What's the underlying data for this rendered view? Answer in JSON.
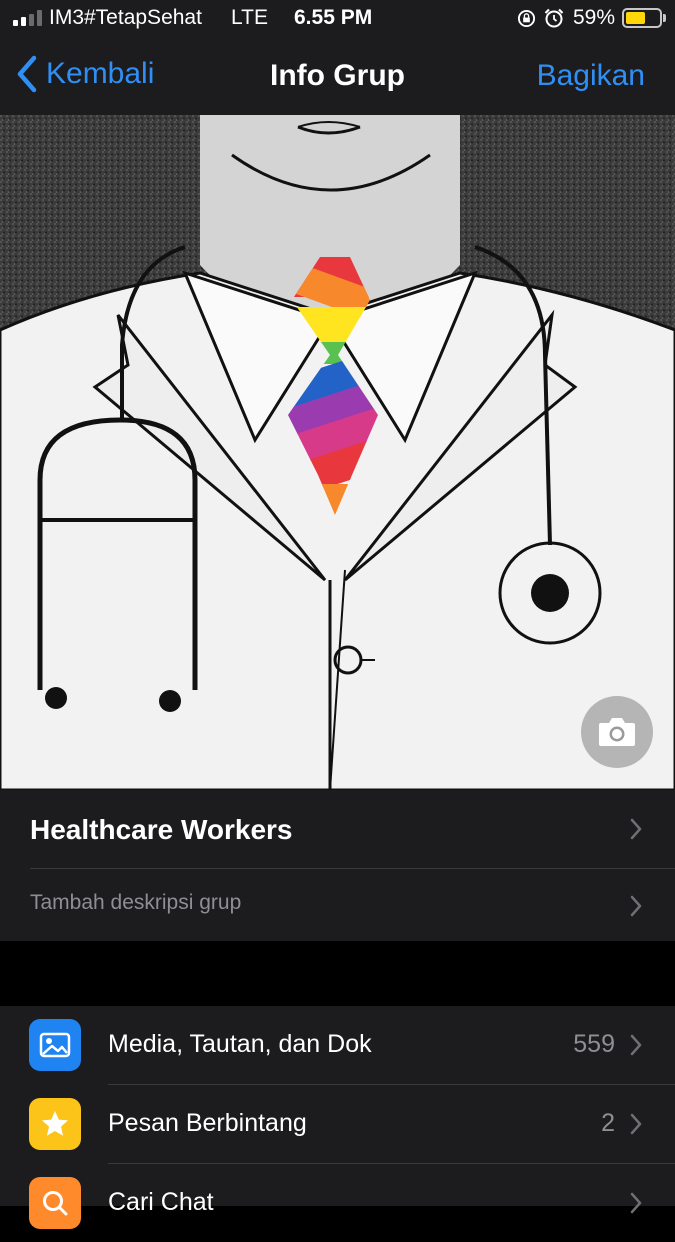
{
  "status": {
    "carrier": "IM3#TetapSehat",
    "network": "LTE",
    "time": "6.55 PM",
    "battery_percent": "59%",
    "battery_level": 0.59
  },
  "nav": {
    "back_label": "Kembali",
    "title": "Info Grup",
    "share_label": "Bagikan"
  },
  "group": {
    "name": "Healthcare Workers",
    "description_placeholder": "Tambah deskripsi grup"
  },
  "items": [
    {
      "label": "Media, Tautan, dan Dok",
      "count": "559",
      "icon": "photo-icon",
      "color": "#1f83f2"
    },
    {
      "label": "Pesan Berbintang",
      "count": "2",
      "icon": "star-icon",
      "color": "#fcc419"
    },
    {
      "label": "Cari Chat",
      "count": "",
      "icon": "search-icon",
      "color": "#ff8a2b"
    }
  ],
  "colors": {
    "accent": "#2f8ff5",
    "background": "#000000",
    "surface": "#1c1c1e",
    "separator": "#3a3a3c",
    "secondary_text": "#8e8e93"
  }
}
